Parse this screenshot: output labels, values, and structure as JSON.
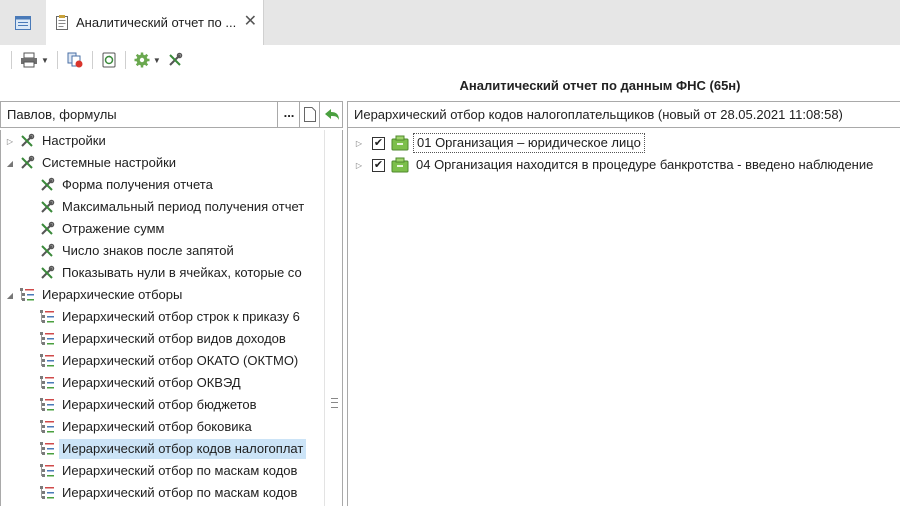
{
  "tabs": {
    "active_title": "Аналитический отчет по ...",
    "close_glyph": "✕"
  },
  "report_title": "Аналитический отчет по данным ФНС (65н)",
  "left_header": {
    "field_value": "Павлов, формулы",
    "ellipsis": "..."
  },
  "left_tree": [
    {
      "label": "Настройки",
      "level": 0,
      "expander": "▷",
      "icon": "tools-icon"
    },
    {
      "label": "Системные настройки",
      "level": 0,
      "expander": "◢",
      "icon": "tools-icon"
    },
    {
      "label": "Форма получения отчета",
      "level": 1,
      "expander": "",
      "icon": "tools-icon"
    },
    {
      "label": "Максимальный период получения отчет",
      "level": 1,
      "expander": "",
      "icon": "tools-icon"
    },
    {
      "label": "Отражение сумм",
      "level": 1,
      "expander": "",
      "icon": "tools-icon"
    },
    {
      "label": "Число знаков после запятой",
      "level": 1,
      "expander": "",
      "icon": "tools-icon"
    },
    {
      "label": "Показывать нули в ячейках, которые со",
      "level": 1,
      "expander": "",
      "icon": "tools-icon"
    },
    {
      "label": "Иерархические отборы",
      "level": 0,
      "expander": "◢",
      "icon": "hierarchy-icon"
    },
    {
      "label": "Иерархический отбор строк к приказу 6",
      "level": 1,
      "expander": "",
      "icon": "hierarchy-icon"
    },
    {
      "label": "Иерархический отбор видов доходов",
      "level": 1,
      "expander": "",
      "icon": "hierarchy-icon"
    },
    {
      "label": "Иерархический отбор ОКАТО (ОКТМО)",
      "level": 1,
      "expander": "",
      "icon": "hierarchy-icon"
    },
    {
      "label": "Иерархический отбор ОКВЭД",
      "level": 1,
      "expander": "",
      "icon": "hierarchy-icon"
    },
    {
      "label": "Иерархический отбор бюджетов",
      "level": 1,
      "expander": "",
      "icon": "hierarchy-icon"
    },
    {
      "label": "Иерархический отбор боковика",
      "level": 1,
      "expander": "",
      "icon": "hierarchy-icon"
    },
    {
      "label": "Иерархический отбор кодов налогоплат",
      "level": 1,
      "expander": "",
      "icon": "hierarchy-icon",
      "selected": true
    },
    {
      "label": "Иерархический отбор по маскам кодов",
      "level": 1,
      "expander": "",
      "icon": "hierarchy-icon"
    },
    {
      "label": "Иерархический отбор по маскам кодов",
      "level": 1,
      "expander": "",
      "icon": "hierarchy-icon"
    }
  ],
  "right_header": "Иерархический отбор кодов налогоплательщиков (новый от 28.05.2021 11:08:58)",
  "right_tree": [
    {
      "label": "01  Организация – юридическое лицо",
      "checked": true,
      "expander": "▷",
      "focused": true
    },
    {
      "label": "04  Организация находится в процедуре банкротства - введено наблюдение",
      "checked": true,
      "expander": "▷",
      "focused": false
    }
  ],
  "checkmark": "✔",
  "colors": {
    "selection": "#cce4f7",
    "tabstrip": "#e6e6e6",
    "folder_green": "#7cbf4a"
  }
}
